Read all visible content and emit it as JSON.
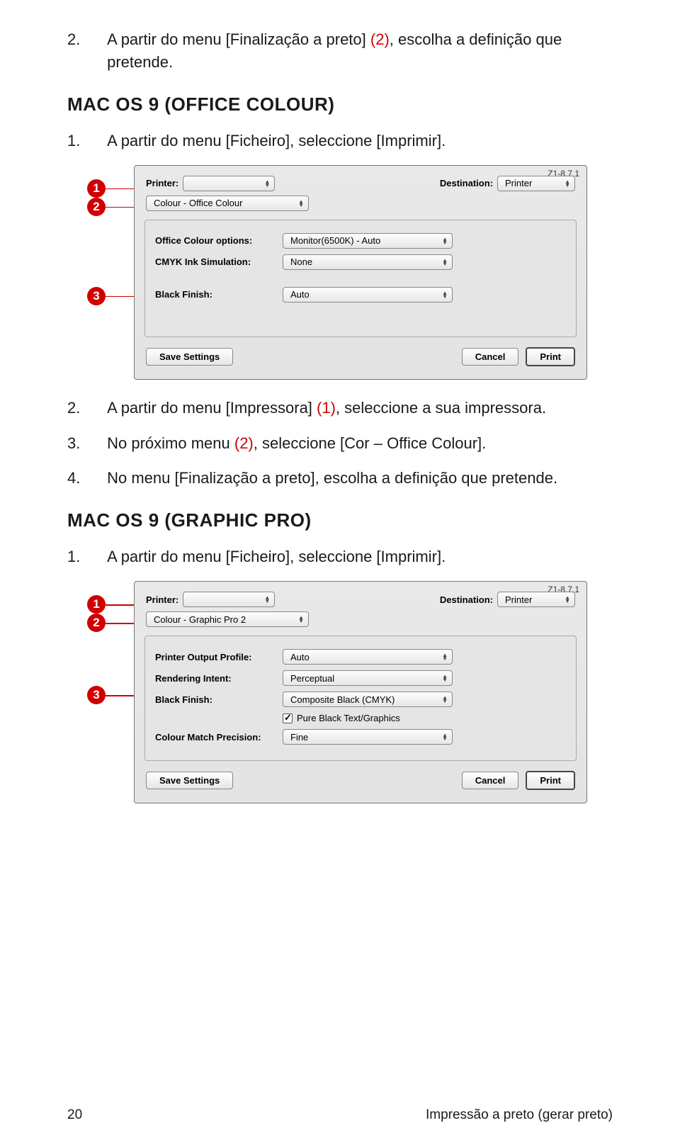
{
  "step2_top": {
    "num": "2.",
    "text_a": "A partir do menu [Finalização a preto] ",
    "ref": "(2)",
    "text_b": ", escolha a definição que pretende."
  },
  "section_office": "MAC OS 9 (OFFICE COLOUR)",
  "office_step1": {
    "num": "1.",
    "text": "A partir do menu [Ficheiro], seleccione [Imprimir]."
  },
  "dialog1": {
    "version": "Z1-8.7.1",
    "printer_label": "Printer:",
    "printer_value": "",
    "dest_label": "Destination:",
    "dest_value": "Printer",
    "panel_select": "Colour - Office Colour",
    "opt1_label": "Office Colour options:",
    "opt1_value": "Monitor(6500K) - Auto",
    "opt2_label": "CMYK Ink Simulation:",
    "opt2_value": "None",
    "opt3_label": "Black Finish:",
    "opt3_value": "Auto",
    "save": "Save Settings",
    "cancel": "Cancel",
    "print": "Print"
  },
  "office_step2": {
    "num": "2.",
    "text_a": "A partir do menu [Impressora] ",
    "ref": "(1)",
    "text_b": ", seleccione a sua impressora."
  },
  "office_step3": {
    "num": "3.",
    "text_a": "No próximo menu ",
    "ref": "(2)",
    "text_b": ", seleccione [Cor – Office Colour]."
  },
  "office_step4": {
    "num": "4.",
    "text": "No menu [Finalização a preto], escolha a definição que pretende."
  },
  "section_graphic": "MAC OS 9 (GRAPHIC PRO)",
  "graphic_step1": {
    "num": "1.",
    "text": "A partir do menu [Ficheiro], seleccione [Imprimir]."
  },
  "dialog2": {
    "version": "Z1-8.7.1",
    "printer_label": "Printer:",
    "printer_value": "",
    "dest_label": "Destination:",
    "dest_value": "Printer",
    "panel_select": "Colour - Graphic Pro 2",
    "opt1_label": "Printer Output Profile:",
    "opt1_value": "Auto",
    "opt2_label": "Rendering Intent:",
    "opt2_value": "Perceptual",
    "opt3_label": "Black Finish:",
    "opt3_value": "Composite Black (CMYK)",
    "chk_label": "Pure Black Text/Graphics",
    "opt4_label": "Colour Match Precision:",
    "opt4_value": "Fine",
    "save": "Save Settings",
    "cancel": "Cancel",
    "print": "Print"
  },
  "footer": {
    "page": "20",
    "title": "Impressão a preto (gerar preto)"
  },
  "callout_nums": {
    "c1": "1",
    "c2": "2",
    "c3": "3"
  }
}
